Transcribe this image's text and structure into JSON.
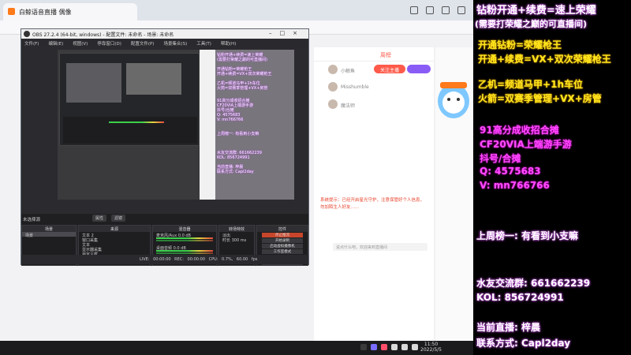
{
  "browser": {
    "tab_title": "白鲸语音直播 偶像",
    "rank_header": "周榜",
    "rank_items": [
      "小鲸鱼",
      "Misshumble",
      "魔法师"
    ],
    "notice_text": "系统提示：已经开启星光守护，注意保管好个人信息，勿加陌生人好友……",
    "pill_label": "关注主播",
    "chat_placeholder": "说点什么吧，欢迎来到直播间"
  },
  "obs": {
    "title": "OBS 27.2.4 (64-bit, windows) - 配置文件: 未命名 - 场景: 未命名",
    "menu": [
      "文件(F)",
      "编辑(E)",
      "视图(V)",
      "停靠窗口(D)",
      "配置文件(P)",
      "场景集合(S)",
      "工具(T)",
      "帮助(H)"
    ],
    "preview_overlay": [
      "钻粉开通+续费=速上荣耀",
      "(需要打荣耀之巅的可直播间)",
      "开通钻粉=荣耀枪王",
      "开通+续费=VX+双次荣耀枪王",
      "乙机=频道马甲+1h车位",
      "火箭=双赛季管理+VX+房管",
      "91高分成收招合摊",
      "CF20VIA上端游手游",
      "抖号/合摊",
      "Q: 4575683",
      "V: mn766766",
      "上周榜一: 有看到小支嘛",
      "水友交流群: 661662239",
      "KOL: 856724991",
      "当前直播: 梓晨",
      "联系方式: Capl2day"
    ],
    "no_source_label": "未选择源",
    "prop_buttons": [
      "属性",
      "滤镜"
    ],
    "docks": {
      "scenes_title": "场景",
      "scenes": [
        "场景"
      ],
      "sources_title": "来源",
      "sources": [
        "文本 2",
        "窗口采集",
        "文本",
        "显示器采集",
        "自定义框",
        "图像",
        "音频输入采集"
      ],
      "mixer_title": "混音器",
      "mixer": [
        {
          "name": "麦克风/Aux",
          "db": "0.0 dB"
        },
        {
          "name": "桌面音频",
          "db": "0.0 dB"
        }
      ],
      "transitions_title": "转场特效",
      "transition_value": "淡出",
      "duration_label": "时长",
      "duration_value": "300 ms",
      "controls_title": "控件",
      "controls": [
        "停止推流",
        "开始录制",
        "启动虚拟摄像机",
        "工作室模式",
        "设置",
        "退出"
      ]
    },
    "status": "LIVE: 00:00:00   REC: 00:00:00   CPU: 0.7%, 60.00 fps"
  },
  "taskbar": {
    "time": "11:50",
    "date": "2022/5/5"
  },
  "panel": {
    "line1": "钻粉开通+续费=速上荣耀",
    "line2": "(需要打荣耀之巅的可直播间)",
    "line3": "开通钻粉=荣耀枪王",
    "line4": "开通+续费=VX+双次荣耀枪王",
    "line5": "乙机=频道马甲+1h车位",
    "line6": "火箭=双赛季管理+VX+房管",
    "line7": "91高分成收招合摊",
    "line8": "CF20VIA上端游手游",
    "line9": "抖号/合摊",
    "line10": "Q: 4575683",
    "line11": "V: mn766766",
    "line12": "上周榜一: 有看到小支嘛",
    "line13": "水友交流群: 661662239",
    "line14": "KOL: 856724991",
    "line15": "当前直播: 梓晨",
    "line16": "联系方式: Capl2day"
  },
  "colors": {
    "neon_white_glow": "#c04ae0",
    "neon_yellow": "#ffe81c",
    "neon_pink": "#ff4bff",
    "obs_bg": "#1f1f22",
    "stop_stream": "#c7462b"
  }
}
